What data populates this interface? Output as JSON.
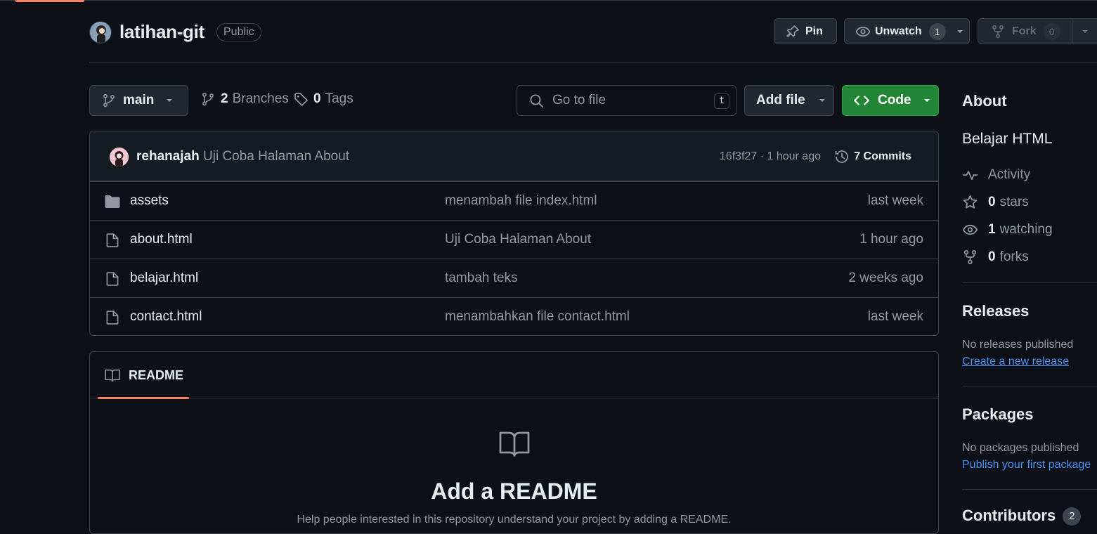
{
  "repo": {
    "name": "latihan-git",
    "visibility": "Public"
  },
  "header_actions": {
    "pin_label": "Pin",
    "unwatch_label": "Unwatch",
    "watch_count": "1",
    "fork_label": "Fork",
    "fork_count": "0"
  },
  "toolbar": {
    "branch": "main",
    "branches_count": "2",
    "branches_label": "Branches",
    "tags_count": "0",
    "tags_label": "Tags",
    "goto_placeholder": "Go to file",
    "goto_shortcut": "t",
    "add_file_label": "Add file",
    "code_label": "Code"
  },
  "latest_commit": {
    "author": "rehanajah",
    "message": "Uji Coba Halaman About",
    "hash_time": "16f3f27 · 1 hour ago",
    "commits_label": "7 Commits"
  },
  "files": [
    {
      "type": "folder",
      "name": "assets",
      "message": "menambah file index.html",
      "time": "last week"
    },
    {
      "type": "file",
      "name": "about.html",
      "message": "Uji Coba Halaman About",
      "time": "1 hour ago"
    },
    {
      "type": "file",
      "name": "belajar.html",
      "message": "tambah teks",
      "time": "2 weeks ago"
    },
    {
      "type": "file",
      "name": "contact.html",
      "message": "menambahkan file contact.html",
      "time": "last week"
    }
  ],
  "readme": {
    "tab_label": "README",
    "title": "Add a README",
    "description": "Help people interested in this repository understand your project by adding a README."
  },
  "about": {
    "heading": "About",
    "description": "Belajar HTML",
    "activity_label": "Activity",
    "stars_count": "0",
    "stars_label": "stars",
    "watching_count": "1",
    "watching_label": "watching",
    "forks_count": "0",
    "forks_label": "forks"
  },
  "releases": {
    "heading": "Releases",
    "empty_text": "No releases published",
    "link": "Create a new release"
  },
  "packages": {
    "heading": "Packages",
    "empty_text": "No packages published",
    "link": "Publish your first package"
  },
  "contributors": {
    "heading": "Contributors",
    "count": "2"
  },
  "colors": {
    "background": "#0d1117",
    "accent_underline": "#f78166",
    "code_button": "#238636",
    "link": "#4493f8"
  }
}
